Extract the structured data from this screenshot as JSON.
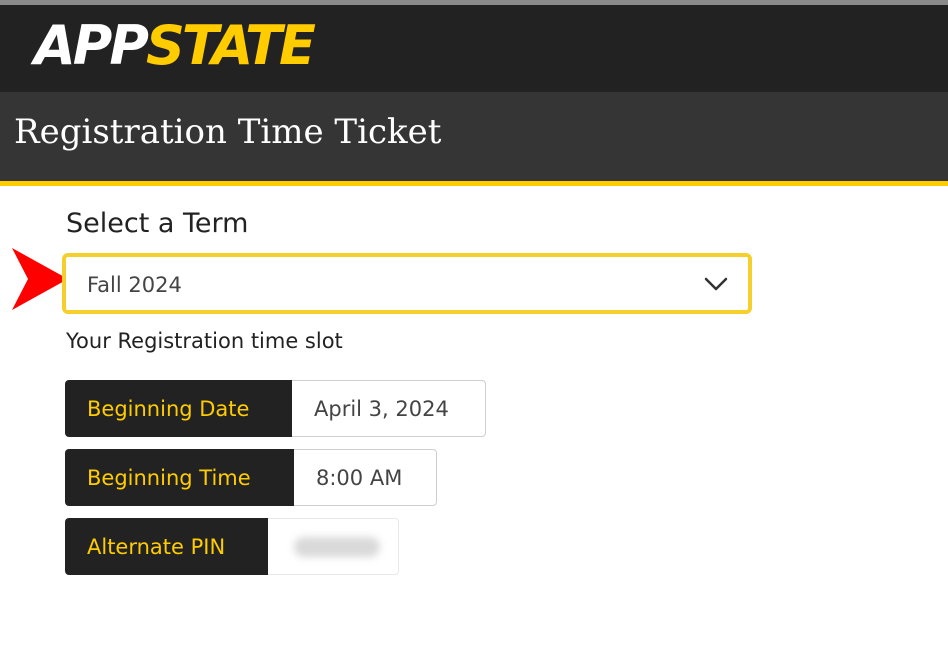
{
  "header": {
    "logo_app": "APP",
    "logo_state": "STATE",
    "brand_colors": {
      "dark": "#222222",
      "gold": "#ffcc00"
    }
  },
  "title_bar": {
    "title": "Registration Time Ticket"
  },
  "term_select": {
    "heading": "Select a Term",
    "selected": "Fall 2024",
    "icon": "chevron-down-icon",
    "highlight_color": "#f5cf2c"
  },
  "annotation": {
    "icon": "red-arrow-pointer",
    "color": "#ff0000"
  },
  "time_slot": {
    "label": "Your Registration time slot",
    "rows": [
      {
        "key": "Beginning Date",
        "value": "April 3, 2024"
      },
      {
        "key": "Beginning Time",
        "value": "8:00 AM"
      },
      {
        "key": "Alternate PIN",
        "value": ""
      }
    ]
  }
}
